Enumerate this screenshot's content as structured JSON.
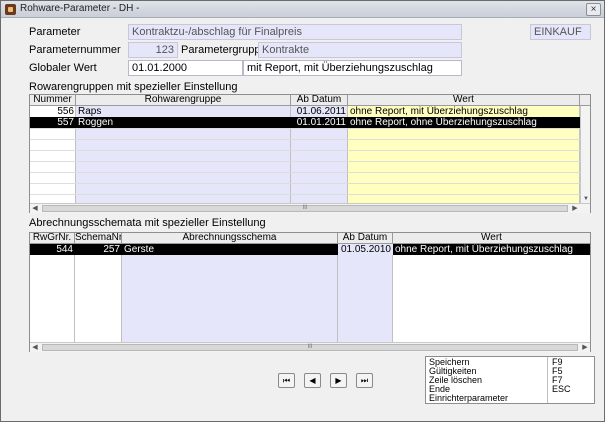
{
  "window": {
    "title": "Rohware-Parameter - DH -",
    "close": "×"
  },
  "form": {
    "parameter_label": "Parameter",
    "parameter_value": "Kontraktzu-/abschlag für Finalpreis",
    "einkauf": "EINKAUF",
    "parameternummer_label": "Parameternummer",
    "parameternummer_value": "123",
    "parametergruppe_label": "Parametergruppe",
    "parametergruppe_value": "Kontrakte",
    "globaler_label": "Globaler Wert",
    "globaler_date": "01.01.2000",
    "globaler_value": "mit Report, mit Überziehungszuschlag"
  },
  "grid1": {
    "title": "Rowarengruppen mit spezieller Einstellung",
    "headers": [
      "Nummer",
      "Rohwarengruppe",
      "Ab Datum",
      "Wert"
    ],
    "rows": [
      {
        "nummer": "556",
        "gruppe": "Raps",
        "datum": "01.06.2011",
        "wert": "ohne Report, mit Überziehungszuschlag"
      },
      {
        "nummer": "557",
        "gruppe": "Roggen",
        "datum": "01.01.2011",
        "wert": "ohne Report, ohne Überziehungszuschlag"
      }
    ]
  },
  "grid2": {
    "title": "Abrechnungsschemata mit spezieller Einstellung",
    "headers": [
      "RwGrNr.",
      "SchemaNr",
      "Abrechnungsschema",
      "Ab Datum",
      "Wert"
    ],
    "rows": [
      {
        "rwgrnr": "544",
        "schemanr": "257",
        "schema": "Gerste",
        "datum": "01.05.2010",
        "wert": "ohne Report, mit Überziehungszuschlag"
      }
    ]
  },
  "scroll": {
    "left": "◀",
    "right": "▶",
    "grip": "III"
  },
  "nav": {
    "first": "⏮",
    "prev": "◀",
    "next": "▶",
    "last": "⏭"
  },
  "shortcuts": [
    {
      "label": "Speichern",
      "key": "F9"
    },
    {
      "label": "Gültigkeiten",
      "key": "F5"
    },
    {
      "label": "Zeile löschen",
      "key": "F7"
    },
    {
      "label": "Ende",
      "key": "ESC"
    },
    {
      "label": "Einrichterparameter",
      "key": ""
    }
  ],
  "colors": {
    "field_bg": "#e6e6fa",
    "selected_row": "#000000",
    "wert_column": "#ffffc0",
    "column_tint": "#e6e6fa"
  }
}
